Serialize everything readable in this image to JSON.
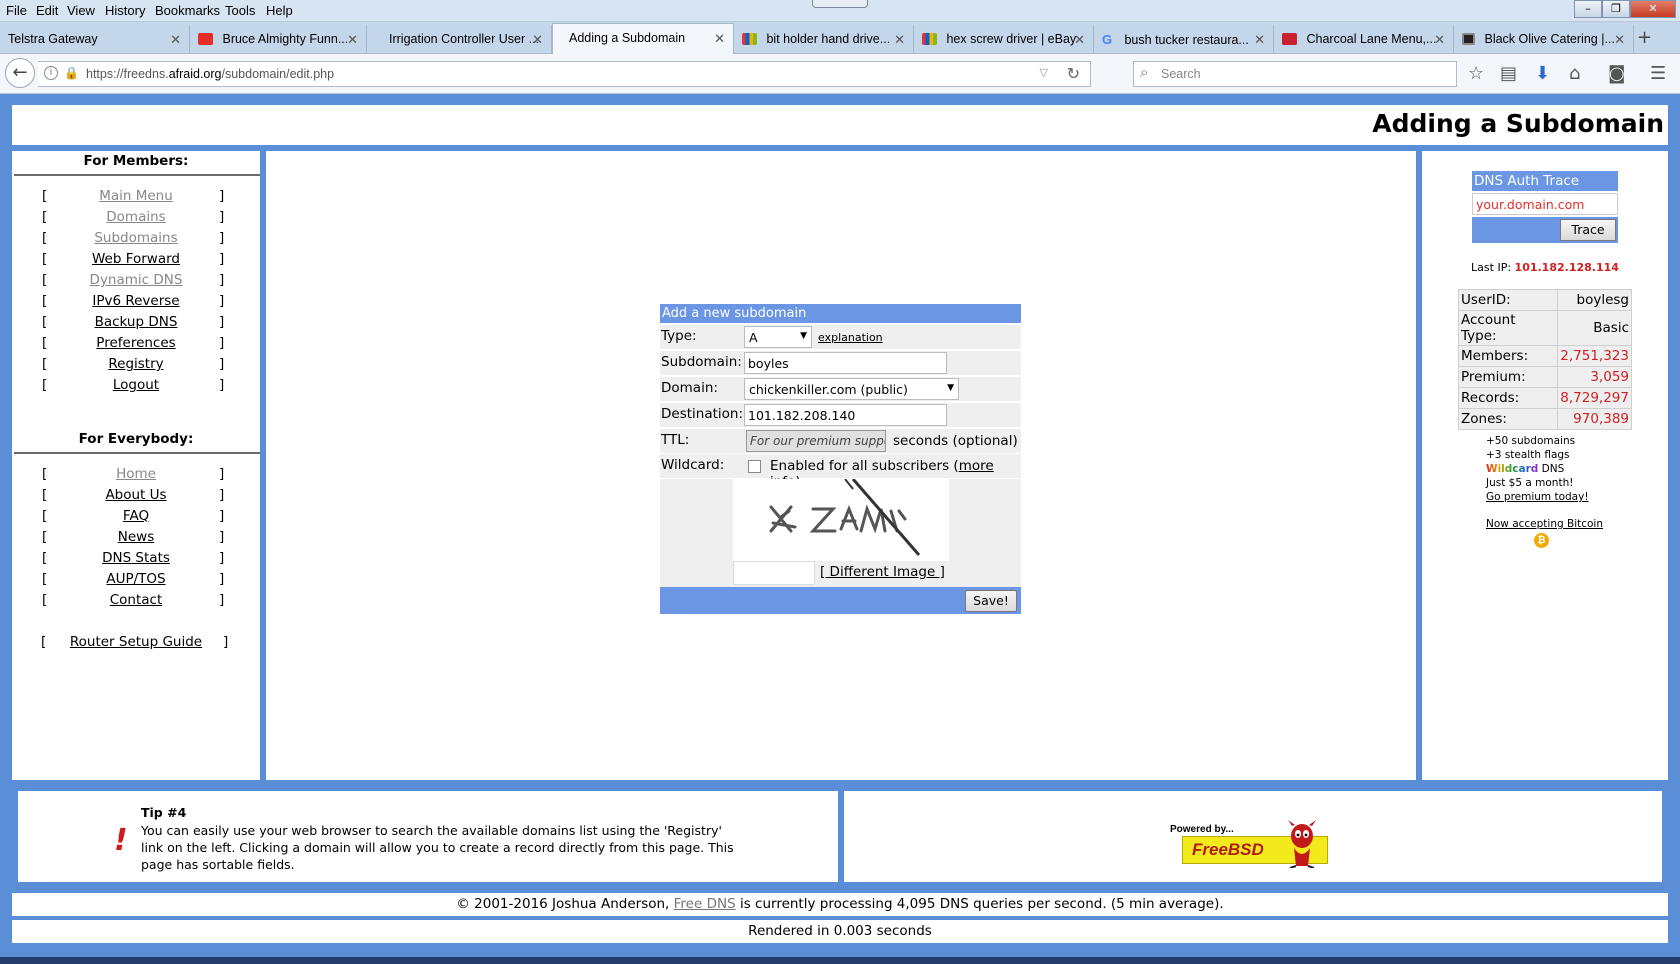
{
  "menu": [
    "File",
    "Edit",
    "View",
    "History",
    "Bookmarks",
    "Tools",
    "Help"
  ],
  "tabs": [
    {
      "label": "Telstra Gateway",
      "icon": "none",
      "color": ""
    },
    {
      "label": "Bruce Almighty Funn...",
      "icon": "youtube-icon",
      "color": "#e52d27"
    },
    {
      "label": "Irrigation Controller User ...",
      "icon": "none",
      "color": ""
    },
    {
      "label": "Adding a Subdomain",
      "icon": "none",
      "color": "",
      "active": true
    },
    {
      "label": "bit holder hand drive...",
      "icon": "ebay-icon",
      "color": "#e53238"
    },
    {
      "label": "hex screw driver | eBay",
      "icon": "ebay-icon",
      "color": "#e53238"
    },
    {
      "label": "bush tucker restaura...",
      "icon": "google-icon",
      "color": "#4285f4"
    },
    {
      "label": "Charcoal Lane Menu,...",
      "icon": "zomato-icon",
      "color": "#cb202d"
    },
    {
      "label": "Black Olive Catering |...",
      "icon": "site-icon",
      "color": "#222222"
    }
  ],
  "nav": {
    "url_prefix": "https://freedns.",
    "url_domain": "afraid.org",
    "url_path": "/subdomain/edit.php",
    "search_placeholder": "Search"
  },
  "page": {
    "title": "Adding a Subdomain",
    "members_heading": "For Members:",
    "members_links": [
      {
        "label": "Main Menu",
        "dim": true
      },
      {
        "label": "Domains",
        "dim": true
      },
      {
        "label": "Subdomains",
        "dim": true
      },
      {
        "label": "Web Forward",
        "dim": false
      },
      {
        "label": "Dynamic DNS",
        "dim": true
      },
      {
        "label": "IPv6 Reverse",
        "dim": false
      },
      {
        "label": "Backup DNS",
        "dim": false
      },
      {
        "label": "Preferences",
        "dim": false
      },
      {
        "label": "Registry",
        "dim": false
      },
      {
        "label": "Logout",
        "dim": false
      }
    ],
    "everybody_heading": "For Everybody:",
    "everybody_links": [
      {
        "label": "Home",
        "dim": true
      },
      {
        "label": "About Us",
        "dim": false
      },
      {
        "label": "FAQ",
        "dim": false
      },
      {
        "label": "News",
        "dim": false
      },
      {
        "label": "DNS Stats",
        "dim": false
      },
      {
        "label": "AUP/TOS",
        "dim": false
      },
      {
        "label": "Contact",
        "dim": false
      }
    ],
    "router_guide": "Router Setup Guide"
  },
  "form": {
    "heading": "Add a new subdomain",
    "type_label": "Type:",
    "type_value": "A",
    "explanation_link": "explanation",
    "subdomain_label": "Subdomain:",
    "subdomain_value": "boyles",
    "domain_label": "Domain:",
    "domain_value": "chickenkiller.com (public)",
    "destination_label": "Destination:",
    "destination_value": "101.182.208.140",
    "ttl_label": "TTL:",
    "ttl_placeholder": "For our premium suppo",
    "ttl_suffix": "seconds (optional)",
    "wildcard_label": "Wildcard:",
    "wildcard_text": "Enabled for all subscribers (",
    "wildcard_more": "more info",
    "wildcard_close": ")",
    "different_image": "[ Different Image ]",
    "save_label": "Save!"
  },
  "sidebar_right": {
    "trace_heading": "DNS Auth Trace",
    "trace_placeholder": "your.domain.com",
    "trace_button": "Trace",
    "last_ip_label": "Last IP:",
    "last_ip": "101.182.128.114",
    "stats": [
      {
        "label": "UserID:",
        "value": "boylesg",
        "red": false
      },
      {
        "label": "Account Type:",
        "value": "Basic",
        "red": false
      },
      {
        "label": "Members:",
        "value": "2,751,323",
        "red": true
      },
      {
        "label": "Premium:",
        "value": "3,059",
        "red": true
      },
      {
        "label": "Records:",
        "value": "8,729,297",
        "red": true
      },
      {
        "label": "Zones:",
        "value": "970,389",
        "red": true
      }
    ],
    "premium_lines": [
      "+50 subdomains",
      "+3 stealth flags"
    ],
    "wildcard_word": "Wildcard",
    "wildcard_dns": " DNS",
    "price_line": "Just $5 a month!",
    "go_premium": "Go premium today!",
    "bitcoin": "Now accepting Bitcoin"
  },
  "tip": {
    "title": "Tip #4",
    "text": "You can easily use your web browser to search the available domains list using the 'Registry' link on the left. Clicking a domain will allow you to create a record directly from this page. This page has sortable fields."
  },
  "powered": {
    "label": "Powered by...",
    "name": "FreeBSD"
  },
  "footer": {
    "copyright_pre": "© 2001-2016 Joshua Anderson, ",
    "copyright_link": "Free DNS",
    "copyright_post": " is currently processing 4,095 DNS queries per second. (5 min average).",
    "rendered": "Rendered in 0.003 seconds"
  }
}
